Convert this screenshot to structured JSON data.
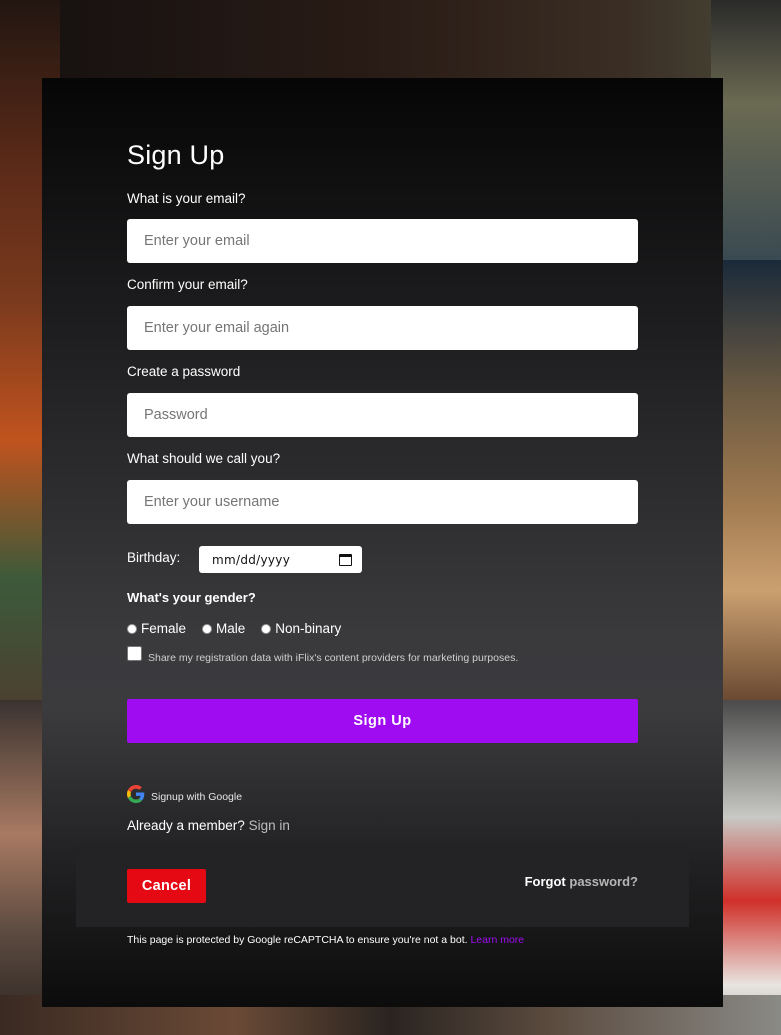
{
  "form": {
    "title": "Sign Up",
    "email": {
      "label": "What is your email?",
      "placeholder": "Enter your email"
    },
    "confirm_email": {
      "label": "Confirm your email?",
      "placeholder": "Enter your email again"
    },
    "password": {
      "label": "Create a password",
      "placeholder": "Password"
    },
    "username": {
      "label": "What should we call you?",
      "placeholder": "Enter your username"
    },
    "birthday": {
      "label": "Birthday:",
      "value": "mm/dd/yyyy",
      "icon": "calendar-icon"
    },
    "gender": {
      "question": "What's your gender?",
      "options": [
        "Female",
        "Male",
        "Non-binary"
      ]
    },
    "consent_text": "Share my registration data with iFlix's content providers for marketing purposes.",
    "signup_label": "Sign Up",
    "google_label": "Signup with Google",
    "member_text": "Already a member?",
    "signin_label": "Sign in"
  },
  "footer": {
    "cancel_label": "Cancel",
    "forgot_bold": "Forgot",
    "forgot_link": "password?",
    "recaptcha_text": "This page is protected by Google reCAPTCHA to ensure you're not a bot.",
    "learn_more": "Learn more"
  },
  "colors": {
    "accent": "#a00cf2",
    "cancel": "#e50914",
    "panel": "#3a3a3d"
  }
}
